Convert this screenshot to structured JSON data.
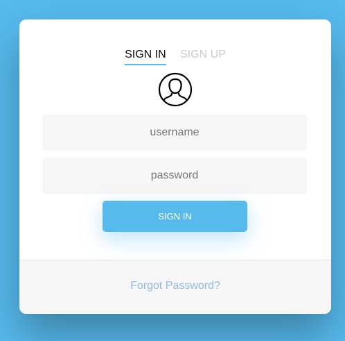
{
  "colors": {
    "background": "#56baed",
    "accent": "#56baed",
    "active_tab": "#0d0d0d",
    "inactive_tab": "#cccccc",
    "field_bg": "#f6f6f6",
    "link": "#92badd"
  },
  "tabs": {
    "sign_in": "SIGN IN",
    "sign_up": "SIGN UP"
  },
  "avatar": {
    "icon": "user-icon"
  },
  "form": {
    "username_placeholder": "username",
    "password_placeholder": "password",
    "submit_label": "SIGN IN"
  },
  "footer": {
    "forgot_label": "Forgot Password?"
  }
}
